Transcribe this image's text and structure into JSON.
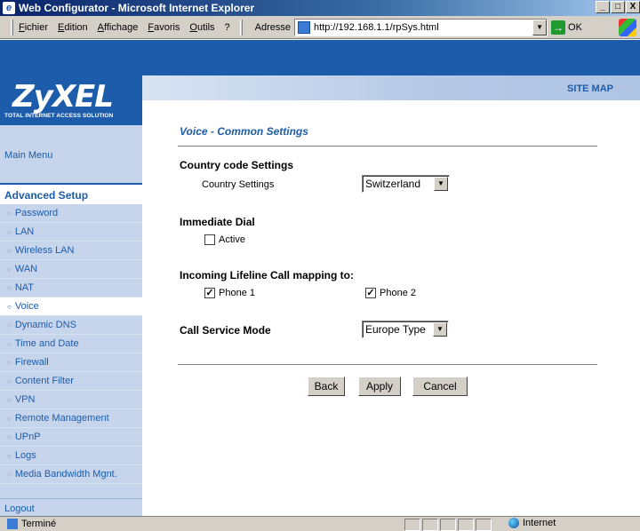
{
  "window": {
    "title": "Web Configurator - Microsoft Internet Explorer",
    "controls": [
      "_",
      "□",
      "X"
    ]
  },
  "menubar": {
    "items": [
      "Fichier",
      "Edition",
      "Affichage",
      "Favoris",
      "Outils",
      "?"
    ],
    "address_label": "Adresse",
    "address_url": "http://192.168.1.1/rpSys.html",
    "go_label": "OK"
  },
  "header": {
    "logo": "ZyXEL",
    "tagline": "TOTAL INTERNET ACCESS SOLUTION",
    "site_map": "SITE MAP",
    "brand_color": "#1c5caa"
  },
  "sidebar": {
    "main_menu": "Main Menu",
    "advanced_setup": "Advanced Setup",
    "items": [
      {
        "label": "Password"
      },
      {
        "label": "LAN"
      },
      {
        "label": "Wireless LAN"
      },
      {
        "label": "WAN"
      },
      {
        "label": "NAT"
      },
      {
        "label": "Voice",
        "active": true
      },
      {
        "label": "Dynamic DNS"
      },
      {
        "label": "Time and Date"
      },
      {
        "label": "Firewall"
      },
      {
        "label": "Content Filter"
      },
      {
        "label": "VPN"
      },
      {
        "label": "Remote Management"
      },
      {
        "label": "UPnP"
      },
      {
        "label": "Logs"
      },
      {
        "label": "Media Bandwidth Mgnt."
      }
    ],
    "logout": "Logout"
  },
  "main": {
    "title": "Voice - Common Settings",
    "country": {
      "heading": "Country code Settings",
      "label": "Country Settings",
      "value": "Switzerland"
    },
    "immediate_dial": {
      "heading": "Immediate Dial",
      "active_label": "Active",
      "active_checked": false
    },
    "lifeline": {
      "heading": "Incoming Lifeline Call mapping to:",
      "phone1_label": "Phone 1",
      "phone1_checked": true,
      "phone2_label": "Phone 2",
      "phone2_checked": true
    },
    "call_service": {
      "heading": "Call Service Mode",
      "value": "Europe Type"
    },
    "buttons": {
      "back": "Back",
      "apply": "Apply",
      "cancel": "Cancel"
    }
  },
  "statusbar": {
    "status": "Terminé",
    "zone": "Internet"
  }
}
